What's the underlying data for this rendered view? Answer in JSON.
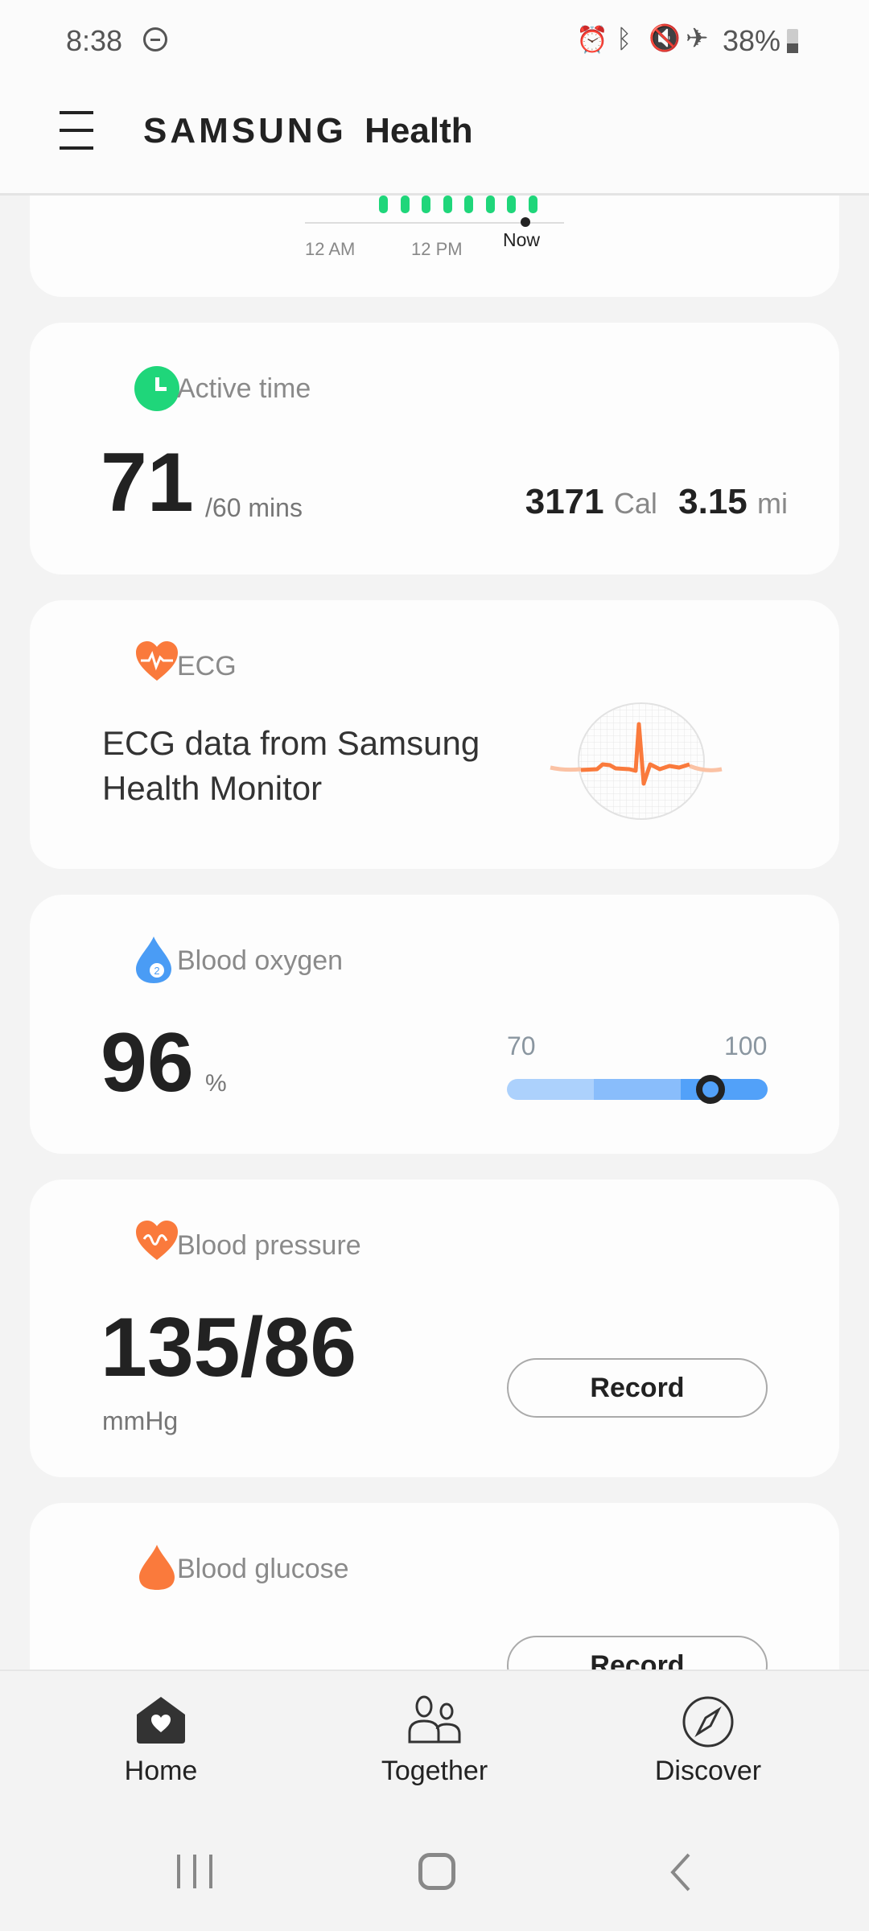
{
  "status_bar": {
    "time": "8:38",
    "battery": "38%",
    "icons": [
      "dnd-icon",
      "alarm-icon",
      "bluetooth-icon",
      "vibrate-mute-icon",
      "airplane-icon",
      "battery-icon"
    ]
  },
  "header": {
    "title_brand": "SAMSUNG",
    "title_app": "Health",
    "menu_icon": "hamburger-menu-icon"
  },
  "steps_chart": {
    "labels": [
      "12 AM",
      "12 PM"
    ],
    "now_label": "Now",
    "bar_color": "#1fd67a"
  },
  "active_time": {
    "title": "Active time",
    "value": "71",
    "goal": "/60 mins",
    "calories": "3171",
    "calories_unit": "Cal",
    "distance": "3.15",
    "distance_unit": "mi",
    "icon_color": "#1fd67a"
  },
  "ecg": {
    "title": "ECG",
    "description": "ECG data from Samsung Health Monitor",
    "accent": "#fa7a3c"
  },
  "blood_oxygen": {
    "title": "Blood oxygen",
    "value": "96",
    "unit": "%",
    "range_min": "70",
    "range_max": "100",
    "level": 96,
    "accent": "#4a9cf5"
  },
  "blood_pressure": {
    "title": "Blood pressure",
    "value": "135/86",
    "unit": "mmHg",
    "record_label": "Record"
  },
  "blood_glucose": {
    "title": "Blood glucose",
    "value": "--",
    "record_label": "Record"
  },
  "bottom_nav": {
    "items": [
      {
        "label": "Home"
      },
      {
        "label": "Together"
      },
      {
        "label": "Discover"
      }
    ]
  }
}
